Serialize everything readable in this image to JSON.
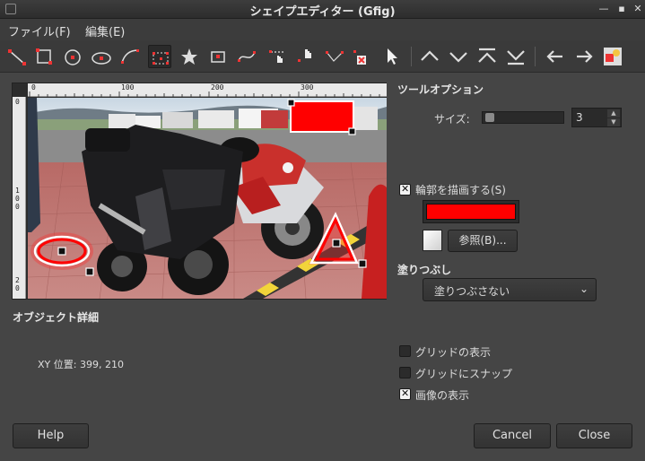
{
  "window": {
    "title": "シェイプエディター (Gfig)"
  },
  "menu": {
    "items": [
      "ファイル(F)",
      "編集(E)"
    ]
  },
  "ruler": {
    "h": [
      "0",
      "100",
      "200",
      "300"
    ],
    "v": [
      "0",
      "1",
      "0",
      "0",
      "2",
      "0"
    ]
  },
  "tool_options": {
    "title": "ツールオプション",
    "size_label": "サイズ:",
    "size_value": "3",
    "size_fraction": 0.02,
    "outline_label": "輪郭を描画する(S)",
    "outline_checked": true,
    "outline_color": "#ff0000",
    "browse_label": "参照(B)...",
    "fill_title": "塗りつぶし",
    "fill_value": "塗りつぶさない"
  },
  "object_details": {
    "title": "オブジェクト詳細",
    "xy": "XY 位置: 399, 210"
  },
  "grid": {
    "show_grid": {
      "label": "グリッドの表示",
      "checked": false
    },
    "snap_grid": {
      "label": "グリッドにスナップ",
      "checked": false
    },
    "show_image": {
      "label": "画像の表示",
      "checked": true
    }
  },
  "buttons": {
    "help": "Help",
    "cancel": "Cancel",
    "close": "Close"
  },
  "colors": {
    "accent": "#ff0000"
  }
}
